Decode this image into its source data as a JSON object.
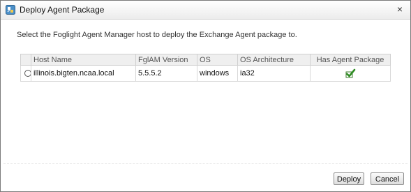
{
  "window": {
    "title": "Deploy Agent Package",
    "close_symbol": "×",
    "icon": "deploy-package-icon"
  },
  "instruction": "Select the Foglight Agent Manager host to deploy the Exchange Agent package to.",
  "table": {
    "columns": [
      "",
      "Host Name",
      "FglAM Version",
      "OS",
      "OS Architecture",
      "Has Agent Package"
    ],
    "rows": [
      {
        "selected": false,
        "host_name": "illinois.bigten.ncaa.local",
        "fglam_version": "5.5.5.2",
        "os": "windows",
        "os_architecture": "ia32",
        "has_agent_package": true,
        "has_agent_package_icon": "checkmark-icon"
      }
    ]
  },
  "buttons": {
    "deploy": "Deploy",
    "cancel": "Cancel"
  },
  "colors": {
    "checkmark": "#2e8b22",
    "header_bg": "#efefef"
  }
}
